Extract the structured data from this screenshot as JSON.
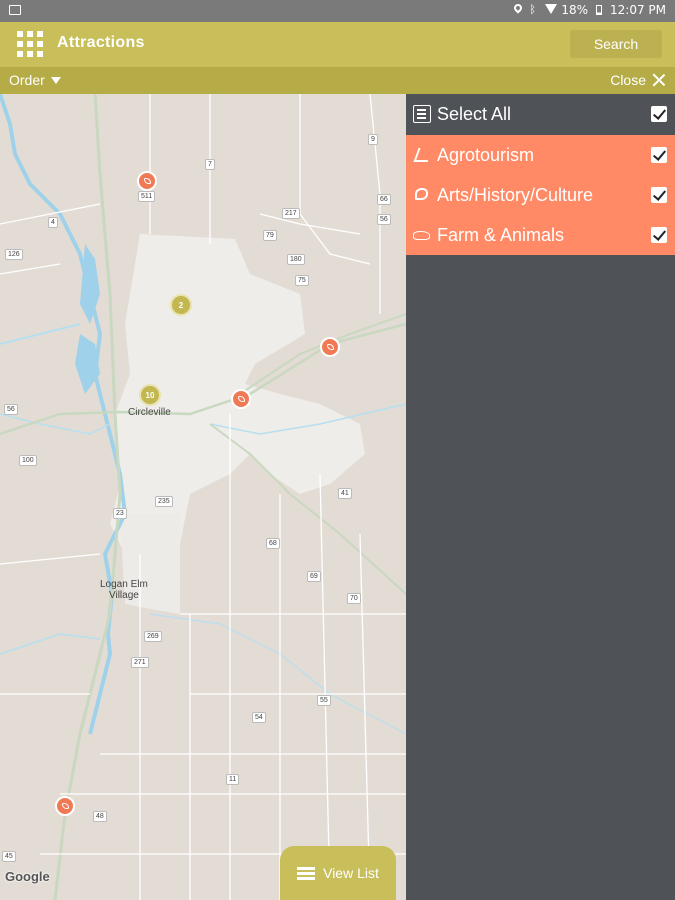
{
  "status_bar": {
    "battery": "18%",
    "time": "12:07 PM"
  },
  "app_bar": {
    "title": "Attractions",
    "search_label": "Search"
  },
  "sub_bar": {
    "order_label": "Order",
    "close_label": "Close"
  },
  "map": {
    "town_labels": [
      "Circleville",
      "Logan Elm\nVillage"
    ],
    "route_numbers": [
      "9",
      "7",
      "217",
      "4",
      "126",
      "79",
      "180",
      "75",
      "66",
      "56",
      "41",
      "235",
      "23",
      "68",
      "69",
      "70",
      "269",
      "271",
      "54",
      "55",
      "11",
      "48",
      "45",
      "56",
      "100",
      "511"
    ],
    "clusters": [
      "2",
      "10"
    ],
    "attribution": "Google"
  },
  "view_list_label": "View List",
  "filters": {
    "select_all_label": "Select All",
    "categories": [
      {
        "label": "Agrotourism",
        "icon": "agrotourism-icon",
        "checked": true
      },
      {
        "label": "Arts/History/Culture",
        "icon": "arts-icon",
        "checked": true
      },
      {
        "label": "Farm & Animals",
        "icon": "farm-animals-icon",
        "checked": true
      }
    ],
    "category_color": "#ff8a65"
  },
  "colors": {
    "accent": "#c8bf5a",
    "panel": "#4f5257",
    "pin": "#f07a55"
  }
}
